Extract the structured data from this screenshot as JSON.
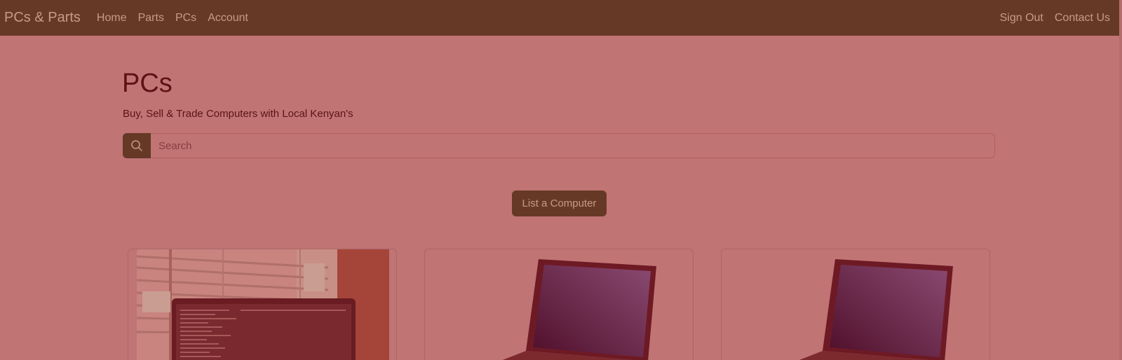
{
  "navbar": {
    "brand": "PCs & Parts",
    "links": [
      "Home",
      "Parts",
      "PCs",
      "Account"
    ],
    "right_links": [
      "Sign Out",
      "Contact Us"
    ]
  },
  "page": {
    "title": "PCs",
    "subtitle": "Buy, Sell & Trade Computers with Local Kenyan's"
  },
  "search": {
    "icon": "search-icon",
    "placeholder": "Search",
    "value": ""
  },
  "actions": {
    "list_button": "List a Computer"
  },
  "listings": [
    {
      "image": "laptop-photo-by-window"
    },
    {
      "image": "laptop-product-photo"
    },
    {
      "image": "laptop-product-photo"
    }
  ],
  "colors": {
    "navbar": "#663927",
    "background": "#c07474",
    "accent": "#663927",
    "heading": "#5e1214"
  }
}
